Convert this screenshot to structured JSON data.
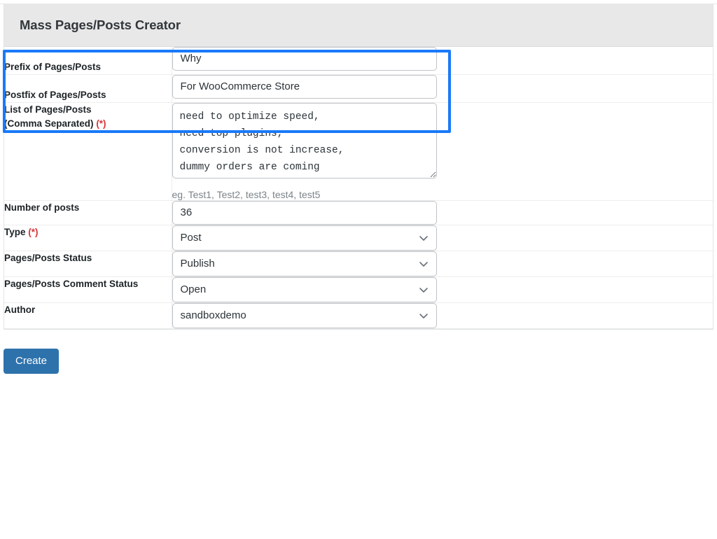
{
  "panel": {
    "title": "Mass Pages/Posts Creator"
  },
  "required_marker": "(*)",
  "rows": {
    "prefix": {
      "label": "Prefix of Pages/Posts",
      "value": "Why",
      "placeholder": ""
    },
    "postfix": {
      "label": "Postfix of Pages/Posts",
      "value": "For WooCommerce Store",
      "placeholder": ""
    },
    "list": {
      "label_line1": "List of Pages/Posts",
      "label_line2": "(Comma Separated)",
      "value": "need to optimize speed,\nneed top plugins,\nconversion is not increase,\ndummy orders are coming",
      "help": "eg. Test1, Test2, test3, test4, test5",
      "placeholder": ""
    },
    "number_of_posts": {
      "label": "Number of posts",
      "value": "36",
      "placeholder": ""
    },
    "type": {
      "label": "Type",
      "value": "Post"
    },
    "status": {
      "label": "Pages/Posts Status",
      "value": "Publish"
    },
    "comment_status": {
      "label": "Pages/Posts Comment Status",
      "value": "Open"
    },
    "author": {
      "label": "Author",
      "value": "sandboxdemo"
    }
  },
  "footer": {
    "create_label": "Create"
  },
  "colors": {
    "highlight_ring": "#1a7af8",
    "primary_button": "#2e72ac",
    "required": "#d63638",
    "header_bg": "#e8e8e8"
  },
  "icons": {
    "chevron": "chevron-down-icon",
    "resize": "resize-handle-icon"
  }
}
